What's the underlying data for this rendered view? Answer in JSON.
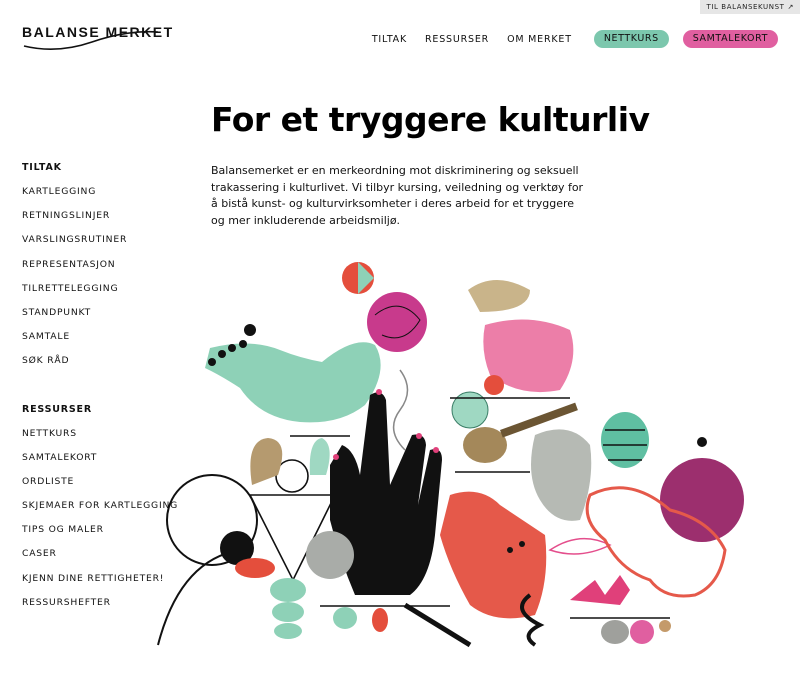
{
  "external_link": {
    "label": "TIL BALANSEKUNST",
    "icon": "external-arrow-icon"
  },
  "logo": {
    "text": "BALANSE MERKET"
  },
  "nav": {
    "links": [
      "TILTAK",
      "RESSURSER",
      "OM MERKET"
    ],
    "pill_nettkurs": "NETTKURS",
    "pill_samtalekort": "SAMTALEKORT",
    "colors": {
      "green": "#7cc7ad",
      "pink": "#e05fa0"
    }
  },
  "page": {
    "title": "For et tryggere kulturliv",
    "intro": "Balansemerket er en merkeordning mot diskriminering og seksuell trakassering i kulturlivet. Vi tilbyr kursing, veiledning og verktøy for å bistå kunst- og kulturvirksomheter i deres arbeid for et tryggere og mer inkluderende arbeidsmiljø."
  },
  "sidebar": {
    "tiltak_heading": "TILTAK",
    "tiltak_items": [
      "KARTLEGGING",
      "RETNINGSLINJER",
      "VARSLINGSRUTINER",
      "REPRESENTASJON",
      "TILRETTELEGGING",
      "STANDPUNKT",
      "SAMTALE",
      "SØK RÅD"
    ],
    "ressurser_heading": "RESSURSER",
    "ressurser_items": [
      "NETTKURS",
      "SAMTALEKORT",
      "ORDLISTE",
      "SKJEMAER FOR KARTLEGGING",
      "TIPS OG MALER",
      "CASER",
      "KJENN DINE RETTIGHETER!",
      "RESSURSHEFTER"
    ]
  }
}
